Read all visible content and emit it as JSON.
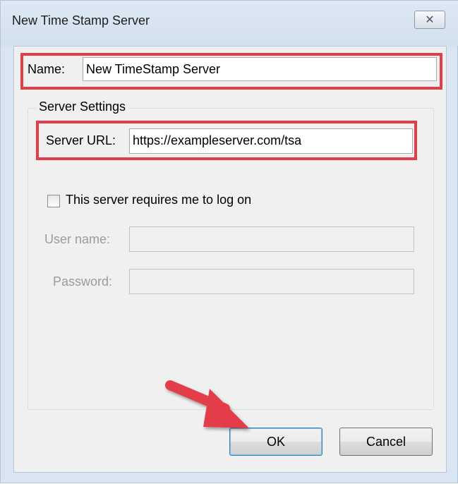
{
  "window": {
    "title": "New Time Stamp Server",
    "close_glyph": "✕"
  },
  "name_field": {
    "label": "Name:",
    "value": "New TimeStamp Server"
  },
  "server_settings": {
    "group_label": "Server Settings",
    "url_label": "Server URL:",
    "url_value": "https://exampleserver.com/tsa",
    "login_checkbox_label": "This server requires me to log on",
    "login_checked": false,
    "username_label": "User name:",
    "username_value": "",
    "password_label": "Password:",
    "password_value": ""
  },
  "buttons": {
    "ok": "OK",
    "cancel": "Cancel"
  },
  "colors": {
    "highlight": "#e33d4a",
    "arrow": "#e33d4a"
  },
  "icons": {
    "close": "close-icon",
    "annotation": "arrow-annotation"
  }
}
